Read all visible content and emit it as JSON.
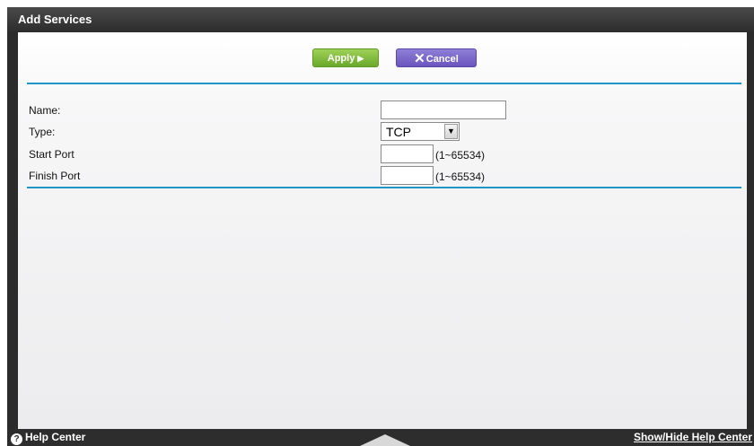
{
  "window": {
    "title": "Add Services"
  },
  "toolbar": {
    "apply_label": "Apply",
    "cancel_label": "Cancel"
  },
  "form": {
    "name_label": "Name:",
    "name_value": "",
    "type_label": "Type:",
    "type_value": "TCP",
    "start_label": "Start Port",
    "start_value": "",
    "start_range": "(1~65534)",
    "finish_label": "Finish Port",
    "finish_value": "",
    "finish_range": "(1~65534)"
  },
  "footer": {
    "help_label": "Help Center",
    "toggle_label": "Show/Hide Help Center"
  },
  "colors": {
    "apply_button": "#7cba3a",
    "cancel_button": "#7b67c9",
    "divider": "#1e96c8",
    "title_bar": "#333333"
  },
  "icons": {
    "apply": "play-arrow-icon",
    "cancel": "close-icon",
    "help": "question-circle-icon",
    "dropdown": "dropdown-arrow-icon"
  }
}
